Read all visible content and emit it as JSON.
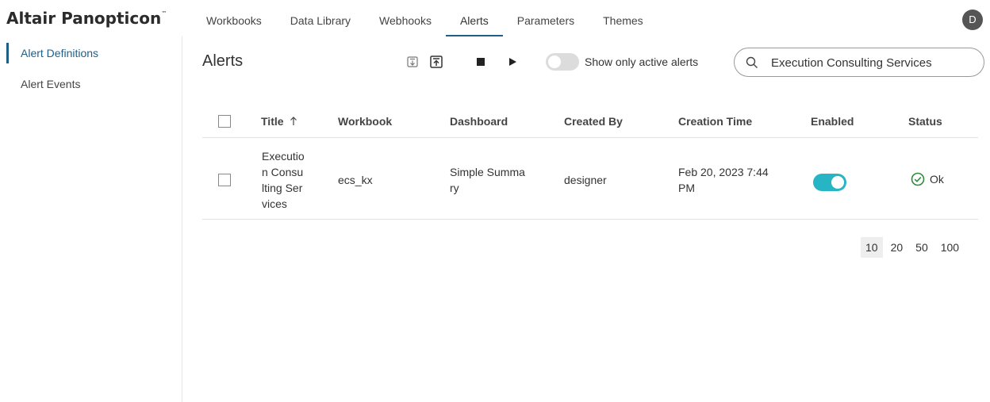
{
  "app": {
    "brand": "Altair Panopticon",
    "trademark": "™"
  },
  "nav": {
    "tabs": [
      {
        "label": "Workbooks"
      },
      {
        "label": "Data Library"
      },
      {
        "label": "Webhooks"
      },
      {
        "label": "Alerts",
        "active": true
      },
      {
        "label": "Parameters"
      },
      {
        "label": "Themes"
      }
    ]
  },
  "user": {
    "initial": "D"
  },
  "sidebar": {
    "items": [
      {
        "label": "Alert Definitions",
        "active": true
      },
      {
        "label": "Alert Events"
      }
    ]
  },
  "page": {
    "title": "Alerts"
  },
  "toolbar": {
    "icons": [
      "export-icon",
      "import-icon",
      "stop-icon",
      "play-icon"
    ]
  },
  "filter": {
    "label": "Show only active alerts",
    "active_only": false
  },
  "search": {
    "value": "Execution Consulting Services",
    "icon": "search-icon"
  },
  "table": {
    "columns": [
      "Title",
      "Workbook",
      "Dashboard",
      "Created By",
      "Creation Time",
      "Enabled",
      "Status"
    ],
    "sort": {
      "column": "Title",
      "direction": "ascending",
      "icon": "arrow-up-icon"
    },
    "rows": [
      {
        "title": "Executio\nn Consu\nlting Ser\nvices",
        "workbook": "ecs_kx",
        "dashboard": "Simple Summa\nry",
        "created_by": "designer",
        "creation_time": "Feb 20, 2023 7:44\nPM",
        "enabled": true,
        "status": "Ok"
      }
    ]
  },
  "pagination": {
    "page_sizes": [
      "10",
      "20",
      "50",
      "100"
    ],
    "selected": "10"
  },
  "colors": {
    "accent": "#1f5f87",
    "toggle_on": "#27b5c6",
    "status_ok": "#2e8b3c"
  }
}
